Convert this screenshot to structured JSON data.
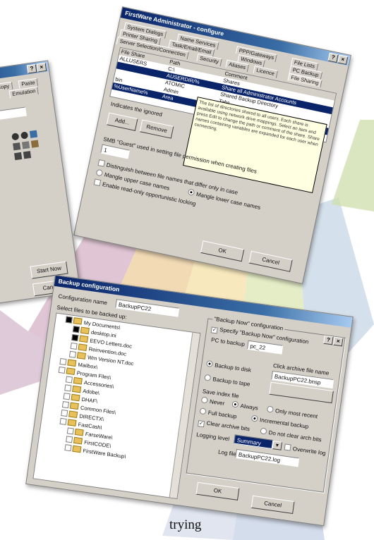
{
  "caption": "trying",
  "top_dialog": {
    "title": "FirstWare Administrator - configure",
    "tabs_row1": [
      "System Dialogs",
      "Name Services",
      "PPP/Gateways",
      "File Lists"
    ],
    "tabs_row2": [
      "Printer Sharing",
      "Task/Email/Email",
      "Windows",
      "PC Backup"
    ],
    "tabs_row3": [
      "Server Selection/Connection",
      "Security",
      "Aliases",
      "Licence",
      "File Sharing"
    ],
    "columns": [
      "File Share",
      "Path",
      "Comment"
    ],
    "rows": [
      {
        "share": "ALLUSERS",
        "path": "C:\\",
        "comment": "Shares"
      },
      {
        "share": "",
        "path": "AUSERDIR/%",
        "comment": "Share all Administrator Accounts"
      },
      {
        "share": "",
        "path": "ATOMIC",
        "comment": "Shared Backup Directory"
      },
      {
        "share": "bin",
        "path": "Admin",
        "comment": "Tabs"
      },
      {
        "share": "%UserName%",
        "path": "Area",
        "comment": "User's Home Directory"
      }
    ],
    "tooltip": "The list of directories shared to all users. Each share is available using network drive mappings. Select an item and press Edit to change the path or comment of the share. Share names containing variables are expanded for each user when connecting.",
    "indicator_note": "Indicates the ignored",
    "add_label": "Add...",
    "remove_label": "Remove",
    "smb_label": "SMB \"Guest\" used in setting file permission when creating files",
    "smb_value": "1",
    "check1": "Distinguish between file names that differ only in case",
    "radio1": "Mangle upper case names",
    "radio2": "Mangle lower case names",
    "check2": "Enable read-only opportunistic locking",
    "ok_label": "OK",
    "cancel_label": "Cancel"
  },
  "left_dialog": {
    "tabs": [
      "Copy",
      "Paste",
      "Emulation"
    ],
    "button_label": "Start Now",
    "cancel_label": "Cancel"
  },
  "backup_dialog": {
    "title": "Backup configuration",
    "config_name_label": "Configuration name",
    "config_name_value": "BackupPC22",
    "files_label": "Select files to be backed up:",
    "tree": [
      {
        "label": "My Documents\\",
        "indent": 1,
        "checked": true
      },
      {
        "label": "desktop.ini",
        "indent": 2,
        "checked": true
      },
      {
        "label": "EEVO Letters.doc",
        "indent": 2,
        "checked": true
      },
      {
        "label": "Reinvention.doc",
        "indent": 2,
        "checked": false
      },
      {
        "label": "Wm Version NT.doc",
        "indent": 2,
        "checked": false
      },
      {
        "label": "Mailbox\\",
        "indent": 1,
        "checked": false
      },
      {
        "label": "Program Files\\",
        "indent": 1,
        "checked": false
      },
      {
        "label": "Accessories\\",
        "indent": 2,
        "checked": false
      },
      {
        "label": "Adobe\\",
        "indent": 2,
        "checked": false
      },
      {
        "label": "DHAF\\",
        "indent": 2,
        "checked": false
      },
      {
        "label": "Common Files\\",
        "indent": 2,
        "checked": false
      },
      {
        "label": "DIRECTX\\",
        "indent": 2,
        "checked": false
      },
      {
        "label": "FastCash\\",
        "indent": 2,
        "checked": false
      },
      {
        "label": "FarseWare\\",
        "indent": 3,
        "checked": false
      },
      {
        "label": "FirstCODE\\",
        "indent": 3,
        "checked": false
      },
      {
        "label": "FirstWare Backup\\",
        "indent": 3,
        "checked": false
      }
    ],
    "sub_title": "\"Backup Now\" configuration",
    "specify_label": "Specify \"Backup Now\" configuration",
    "pc_label": "PC to backup",
    "pc_value": "pc_22",
    "backup_disk": "Backup to disk",
    "archive_label": "Click archive file name",
    "archive_value": "BackupPC22.bnsp",
    "backup_tape": "Backup to tape",
    "save_label": "Save index file",
    "never": "Never",
    "always": "Always",
    "only_recent": "Only most recent",
    "full_backup": "Full backup",
    "incremental": "Incremental backup",
    "clear_archive": "Clear archive bits",
    "no_clear": "Do not clear arch bits",
    "logging_label": "Logging level",
    "logging_value": "Summary",
    "overwrite": "Overwrite log",
    "logfile_label": "Log file",
    "logfile_value": "BackupPC22.log",
    "ok_label": "OK",
    "cancel_label": "Cancel"
  }
}
